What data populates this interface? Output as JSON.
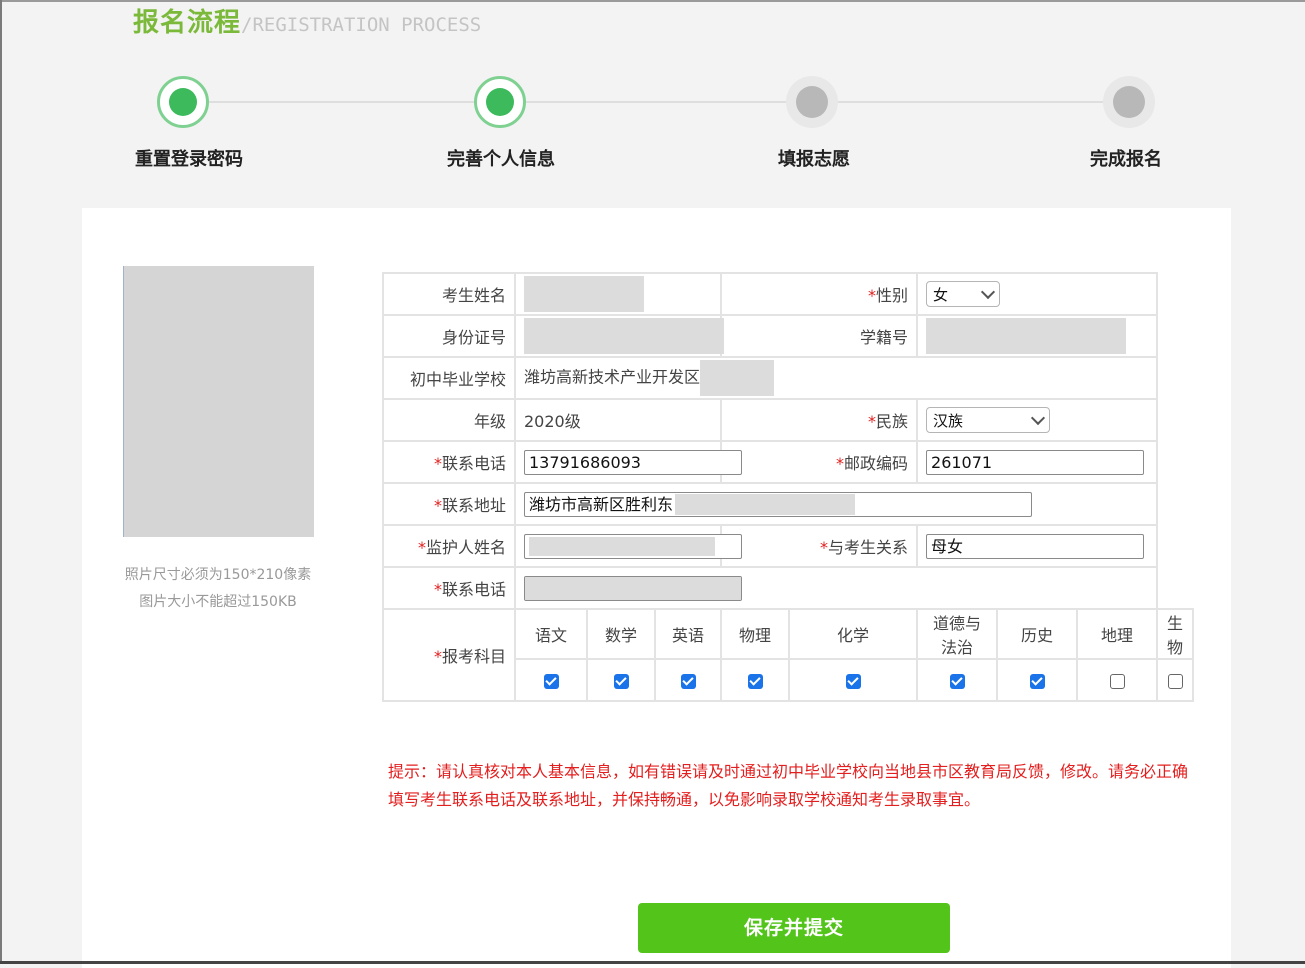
{
  "header": {
    "title_cn": "报名流程",
    "title_en": "/REGISTRATION PROCESS"
  },
  "steps": [
    {
      "label": "重置登录密码",
      "status": "done"
    },
    {
      "label": "完善个人信息",
      "status": "done"
    },
    {
      "label": "填报志愿",
      "status": "todo"
    },
    {
      "label": "完成报名",
      "status": "todo"
    }
  ],
  "photo": {
    "note_line1": "照片尺寸必须为150*210像素",
    "note_line2": "图片大小不能超过150KB"
  },
  "form": {
    "name_label": "考生姓名",
    "required_mark": "*",
    "gender_label": "性别",
    "gender_value": "女",
    "id_label": "身份证号",
    "student_no_label": "学籍号",
    "school_label": "初中毕业学校",
    "school_value": "潍坊高新技术产业开发区",
    "grade_label": "年级",
    "grade_value": "2020级",
    "ethnicity_label": "民族",
    "ethnicity_value": "汉族",
    "phone_label": "联系电话",
    "phone_value": "13791686093",
    "postcode_label": "邮政编码",
    "postcode_value": "261071",
    "address_label": "联系地址",
    "address_value": "潍坊市高新区胜利东",
    "guardian_label": "监护人姓名",
    "relation_label": "与考生关系",
    "relation_value": "母女",
    "guardian_phone_label": "联系电话",
    "subjects_label": "报考科目",
    "subjects": [
      {
        "name": "语文",
        "checked": true
      },
      {
        "name": "数学",
        "checked": true
      },
      {
        "name": "英语",
        "checked": true
      },
      {
        "name": "物理",
        "checked": true
      },
      {
        "name": "化学",
        "checked": true
      },
      {
        "name": "道德与法治",
        "checked": true
      },
      {
        "name": "历史",
        "checked": true
      },
      {
        "name": "地理",
        "checked": false
      },
      {
        "name": "生物",
        "checked": false
      }
    ]
  },
  "tip": {
    "text": "提示：请认真核对本人基本信息，如有错误请及时通过初中毕业学校向当地县市区教育局反馈，修改。请务必正确填写考生联系电话及联系地址，并保持畅通，以免影响录取学校通知考生录取事宜。"
  },
  "submit": {
    "label": "保存并提交"
  },
  "colors": {
    "brand_green": "#7bb93a",
    "step_done": "#3cba5c",
    "step_todo": "#b8b8b8",
    "required": "#e02020",
    "tip": "#e31e1e",
    "button": "#52c41a",
    "checkbox": "#1a73e8"
  }
}
